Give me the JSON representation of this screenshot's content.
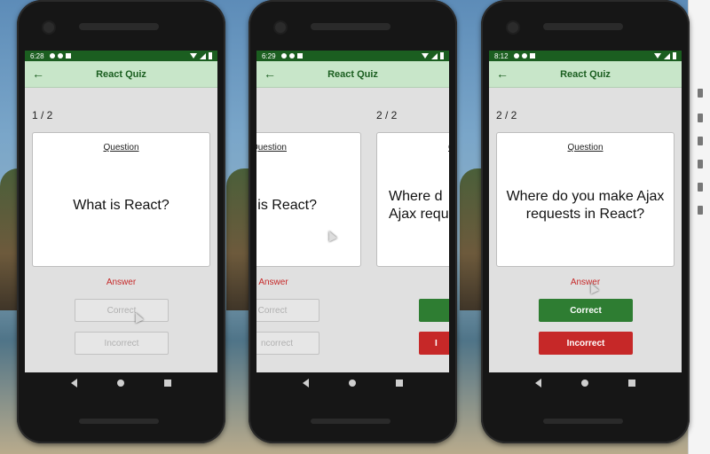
{
  "app": {
    "title": "React Quiz"
  },
  "phones": [
    {
      "time": "6:28",
      "counter": "1 / 2",
      "card_label": "Question",
      "question": "What is React?",
      "answer_label": "Answer",
      "correct_label": "Correct",
      "incorrect_label": "Incorrect"
    },
    {
      "time": "6:29",
      "counter": "2 / 2",
      "prev_card_label": "Question",
      "prev_question": "t is React?",
      "next_card_label": "Q",
      "next_question": "Where d\nAjax requ",
      "answer_label": "Answer",
      "correct_label": "Correct",
      "incorrect_label": "ncorrect",
      "partial_incorrect_label": "I"
    },
    {
      "time": "8:12",
      "counter": "2 / 2",
      "card_label": "Question",
      "question": "Where do you make Ajax requests in React?",
      "answer_label": "Answer",
      "correct_label": "Correct",
      "incorrect_label": "Incorrect"
    }
  ],
  "colors": {
    "appbar_bg": "#c8e6c9",
    "appbar_text": "#1b5e20",
    "statusbar_bg": "#1b5e20",
    "answer_text": "#c62828",
    "correct_bg": "#2e7d32",
    "incorrect_bg": "#c62828"
  }
}
